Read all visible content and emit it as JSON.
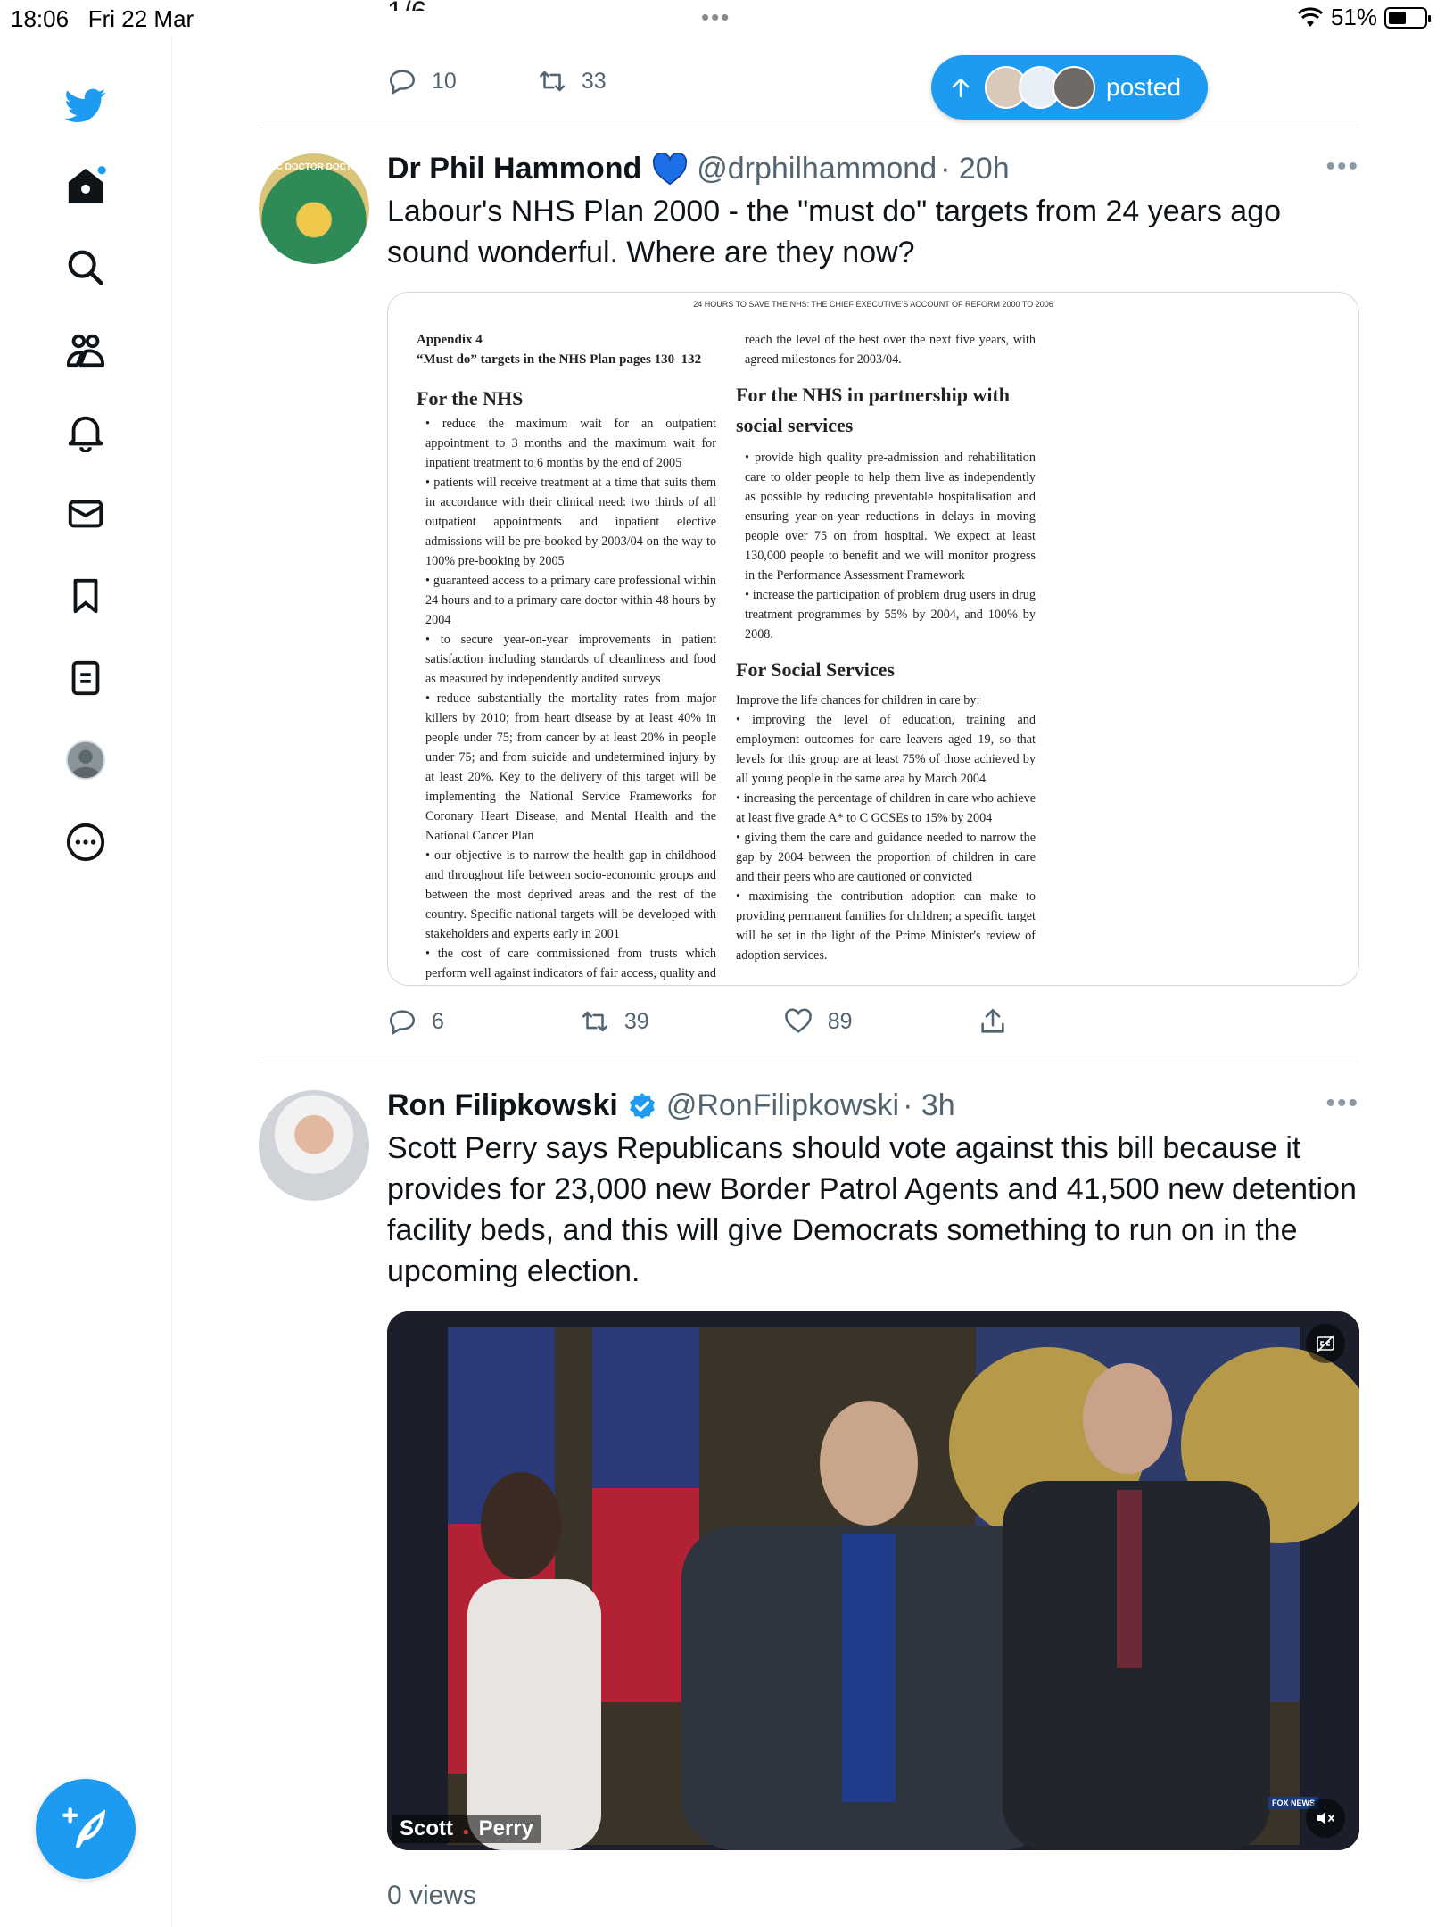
{
  "status_bar": {
    "time": "18:06",
    "date": "Fri 22 Mar",
    "battery": "51%",
    "battery_level": 0.51
  },
  "sidebar": {
    "items": [
      {
        "name": "twitter-logo-icon"
      },
      {
        "name": "home-icon"
      },
      {
        "name": "search-icon"
      },
      {
        "name": "communities-icon"
      },
      {
        "name": "notifications-icon"
      },
      {
        "name": "messages-icon"
      },
      {
        "name": "bookmarks-icon"
      },
      {
        "name": "lists-icon"
      },
      {
        "name": "profile-icon"
      },
      {
        "name": "more-icon"
      }
    ],
    "compose_icon": "compose-feather-icon"
  },
  "colors": {
    "accent": "#1d9bf0",
    "text": "#0f1419",
    "secondary_text": "#536471",
    "divider": "#dfe3e6"
  },
  "previous_tweet": {
    "partial_text": "1/6",
    "replies": "10",
    "retweets": "33"
  },
  "new_posts_pill": {
    "label": "posted"
  },
  "tweets": [
    {
      "author": "Dr Phil Hammond",
      "verified_badge": "blue-heart",
      "handle": "@drphilhammond",
      "time": "· 20h",
      "text": "Labour's NHS Plan 2000 - the \"must do\" targets from 24 years ago sound wonderful. Where are they now?",
      "avatar_label": "BBC DOCTOR DOCTOR",
      "image": {
        "header": "24 HOURS TO SAVE THE NHS: THE CHIEF EXECUTIVE'S ACCOUNT OF REFORM 2000 TO 2006",
        "appendix": "Appendix 4",
        "appendix_sub": "“Must do” targets in the NHS Plan pages 130–132",
        "left_heading": "For the NHS",
        "left_body": "• reduce the maximum wait for an outpatient appointment to 3 months and the maximum wait for inpatient treatment to 6 months by the end of 2005\n• patients will receive treatment at a time that suits them in accordance with their clinical need: two thirds of all outpatient appointments and inpatient elective admissions will be pre-booked by 2003/04 on the way to 100% pre-booking by 2005\n• guaranteed access to a primary care professional within 24 hours and to a primary care doctor within 48 hours by 2004\n• to secure year-on-year improvements in patient satisfaction including standards of cleanliness and food as measured by independently audited surveys\n• reduce substantially the mortality rates from major killers by 2010; from heart disease by at least 40% in people under 75; from cancer by at least 20% in people under 75; and from suicide and undetermined injury by at least 20%. Key to the delivery of this target will be implementing the National Service Frameworks for Coronary Heart Disease, and Mental Health and the National Cancer Plan\n• our objective is to narrow the health gap in childhood and throughout life between socio-economic groups and between the most deprived areas and the rest of the country. Specific national targets will be developed with stakeholders and experts early in 2001\n• the cost of care commissioned from trusts which perform well against indicators of fair access, quality and responsiveness will become the benchmark for the NHS. Everyone will be expected to",
        "right_top": "reach the level of the best over the next five years, with agreed milestones for 2003/04.",
        "right_heading_1": "For the NHS in partnership with social services",
        "right_body_1": "• provide high quality pre-admission and rehabilitation care to older people to help them live as independently as possible by reducing preventable hospitalisation and ensuring year-on-year reductions in delays in moving people over 75 on from hospital. We expect at least 130,000 people to benefit and we will monitor progress in the Performance Assessment Framework\n• increase the participation of problem drug users in drug treatment programmes by 55% by 2004, and 100% by 2008.",
        "right_heading_2": "For Social Services",
        "right_body_2": "Improve the life chances for children in care by:\n• improving the level of education, training and employment outcomes for care leavers aged 19, so that levels for this group are at least 75% of those achieved by all young people in the same area by March 2004\n• increasing the percentage of children in care who achieve at least five grade A* to C GCSEs to 15% by 2004\n• giving them the care and guidance needed to narrow the gap by 2004 between the proportion of children in care and their peers who are cautioned or convicted\n• maximising the contribution adoption can make to providing permanent families for children; a specific target will be set in the light of the Prime Minister's review of adoption services."
      },
      "replies": "6",
      "retweets": "39",
      "likes": "89"
    },
    {
      "author": "Ron Filipkowski",
      "verified_badge": "blue-check",
      "handle": "@RonFilipkowski",
      "time": "· 3h",
      "text": "Scott Perry says Republicans should vote against this bill because it provides for 23,000 new Border Patrol Agents and 41,500 new detention facility beds, and this will give Democrats something to run on in the upcoming election.",
      "video": {
        "caption_first": "Scott",
        "caption_last": "Perry",
        "network": "FOX NEWS"
      },
      "views": "0 views"
    }
  ]
}
